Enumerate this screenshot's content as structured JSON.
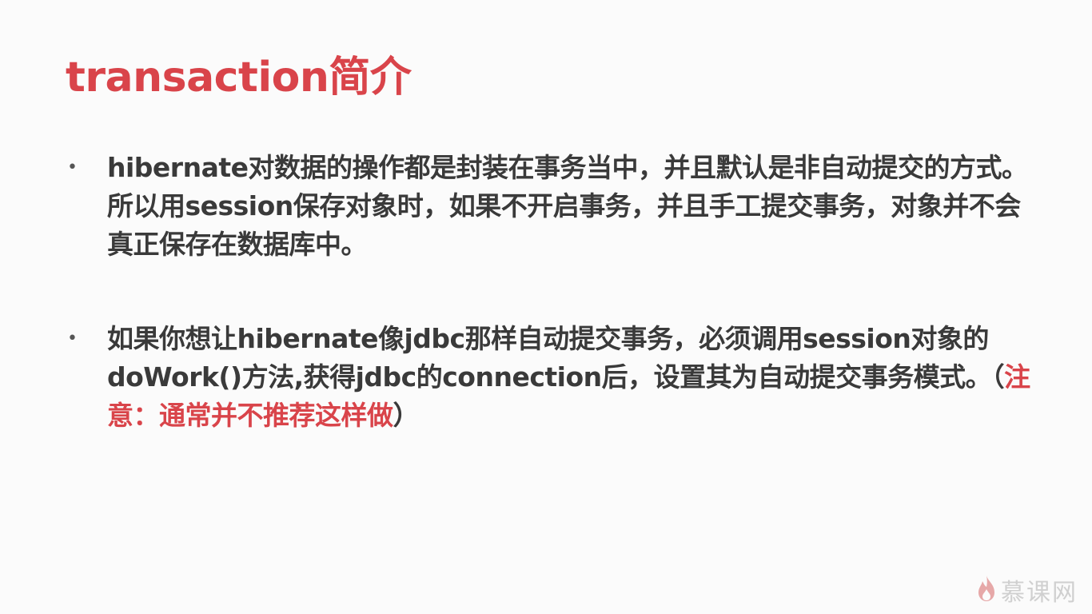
{
  "slide": {
    "title": "transaction简介",
    "bullets": [
      {
        "text": "hibernate对数据的操作都是封装在事务当中，并且默认是非自动提交的方式。所以用session保存对象时，如果不开启事务，并且手工提交事务，对象并不会真正保存在数据库中。"
      },
      {
        "text": "如果你想让hibernate像jdbc那样自动提交事务，必须调用session对象的doWork()方法,获得jdbc的connection后，设置其为自动提交事务模式。（",
        "note": "注意：通常并不推荐这样做",
        "text_end": "）"
      }
    ]
  },
  "logo": {
    "icon": "flame-icon",
    "text": "慕课网"
  },
  "colors": {
    "accent": "#d9444a",
    "body_text": "#3a3a3a",
    "background": "#fbfbfb",
    "logo": "#d0d0d0"
  }
}
